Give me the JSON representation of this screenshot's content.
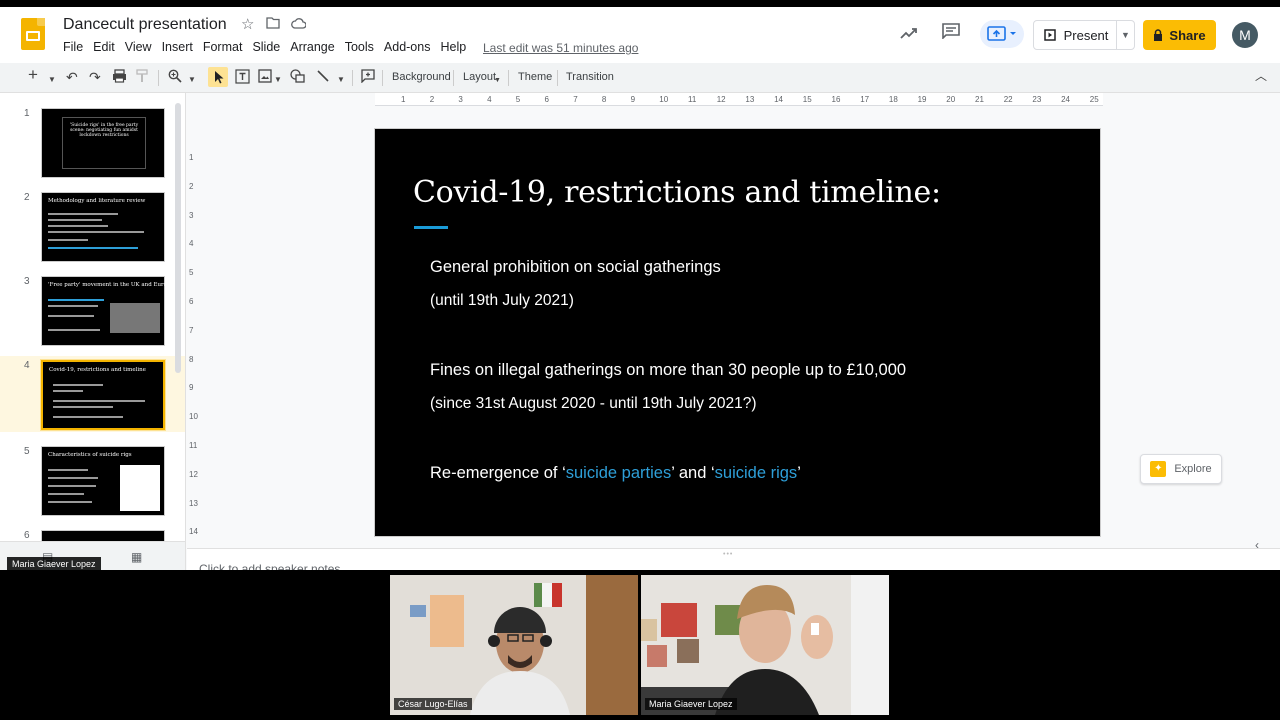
{
  "header": {
    "doc_title": "Dancecult presentation",
    "menus": [
      "File",
      "Edit",
      "View",
      "Insert",
      "Format",
      "Slide",
      "Arrange",
      "Tools",
      "Add-ons",
      "Help"
    ],
    "last_edit": "Last edit was 51 minutes ago",
    "present_label": "Present",
    "share_label": "Share",
    "avatar_initial": "M"
  },
  "toolbar": {
    "background_label": "Background",
    "layout_label": "Layout",
    "theme_label": "Theme",
    "transition_label": "Transition"
  },
  "filmstrip": {
    "slides": [
      {
        "num": "1",
        "title": "'Suicide rigs' in the free party scene: negotiating fun amidst lockdown restrictions"
      },
      {
        "num": "2",
        "title": "Methodology and literature review"
      },
      {
        "num": "3",
        "title": "'Free party' movement in the UK and Europe"
      },
      {
        "num": "4",
        "title": "Covid-19, restrictions and timeline"
      },
      {
        "num": "5",
        "title": "Characteristics of suicide rigs"
      },
      {
        "num": "6",
        "title": ""
      }
    ]
  },
  "ruler": {
    "top": [
      "1",
      "2",
      "3",
      "4",
      "5",
      "6",
      "7",
      "8",
      "9",
      "10",
      "11",
      "12",
      "13",
      "14",
      "15",
      "16",
      "17",
      "18",
      "19",
      "20",
      "21",
      "22",
      "23",
      "24",
      "25"
    ],
    "left": [
      "1",
      "2",
      "3",
      "4",
      "5",
      "6",
      "7",
      "8",
      "9",
      "10",
      "11",
      "12",
      "13",
      "14"
    ]
  },
  "slide": {
    "title": "Covid-19, restrictions and timeline:",
    "line1": "General prohibition on social gatherings",
    "line2": "(until 19th July 2021)",
    "line3": "Fines on illegal gatherings on more than 30 people up to £10,000",
    "line4": "(since 31st August 2020 - until 19th July 2021?)",
    "line5_prefix": "Re-emergence of ‘",
    "line5_link1": "suicide parties",
    "line5_mid": "’ and ‘",
    "line5_link2": "suicide rigs",
    "line5_suffix": "’",
    "accent_color": "#1a9bd7"
  },
  "notes_placeholder": "Click to add speaker notes",
  "explore_label": "Explore",
  "presenter_label": "Maria Giaever Lopez",
  "participants": [
    {
      "name": "César Lugo-Elías"
    },
    {
      "name": "Maria Giaever Lopez"
    }
  ]
}
